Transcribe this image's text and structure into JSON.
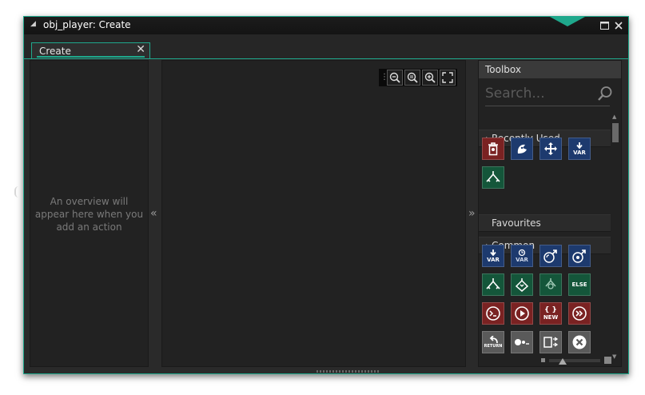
{
  "window": {
    "title": "obj_player: Create"
  },
  "tab": {
    "label": "Create",
    "close_glyph": "✕"
  },
  "left_panel": {
    "message": "An overview will appear here when you add an action"
  },
  "collapse": {
    "left": "«",
    "right": "»"
  },
  "zoom": {
    "icons": [
      "zoom-out-icon",
      "zoom-reset-icon",
      "zoom-in-icon",
      "fit-screen-icon"
    ]
  },
  "toolbox": {
    "title": "Toolbox",
    "search_placeholder": "Search...",
    "sections": {
      "recent": "Recently Used",
      "favourites": "Favourites",
      "common": "Common"
    },
    "tile_labels": {
      "var": "VAR",
      "else": "ELSE",
      "new": "NEW",
      "return": "RETURN"
    }
  },
  "colors": {
    "accent": "#1fa88c",
    "blue": "#1d3a6e",
    "green": "#14563a",
    "red": "#7a2222"
  }
}
